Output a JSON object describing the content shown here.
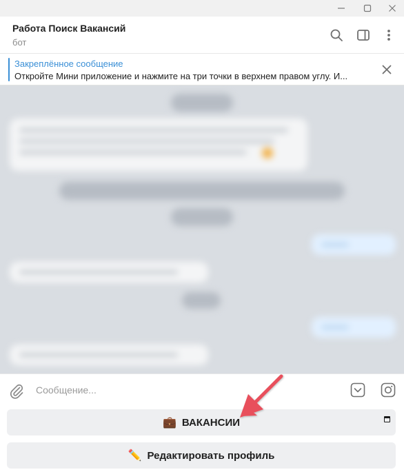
{
  "window": {
    "minimize_label": "",
    "maximize_label": "",
    "close_label": ""
  },
  "header": {
    "title": "Работа Поиск Вакансий",
    "subtitle": "бот",
    "icons": [
      "search-icon",
      "sidebar-toggle-icon",
      "more-vertical-icon"
    ]
  },
  "pinned": {
    "title": "Закреплённое сообщение",
    "text": "Откройте Мини приложение и нажмите на три точки в верхнем правом углу. И..."
  },
  "composer": {
    "placeholder": "Сообщение...",
    "icons": [
      "paperclip-icon",
      "bot-keyboard-icon",
      "instagram-icon"
    ]
  },
  "keyboard": {
    "buttons": [
      {
        "icon": "💼",
        "label": "ВАКАНСИИ"
      },
      {
        "icon": "✏️",
        "label": "Редактировать профиль"
      }
    ]
  },
  "colors": {
    "accent": "#3a8fd6",
    "annotation_arrow": "#e8505b",
    "chat_background": "#d9dde2",
    "keyboard_button": "#eeeff1"
  }
}
